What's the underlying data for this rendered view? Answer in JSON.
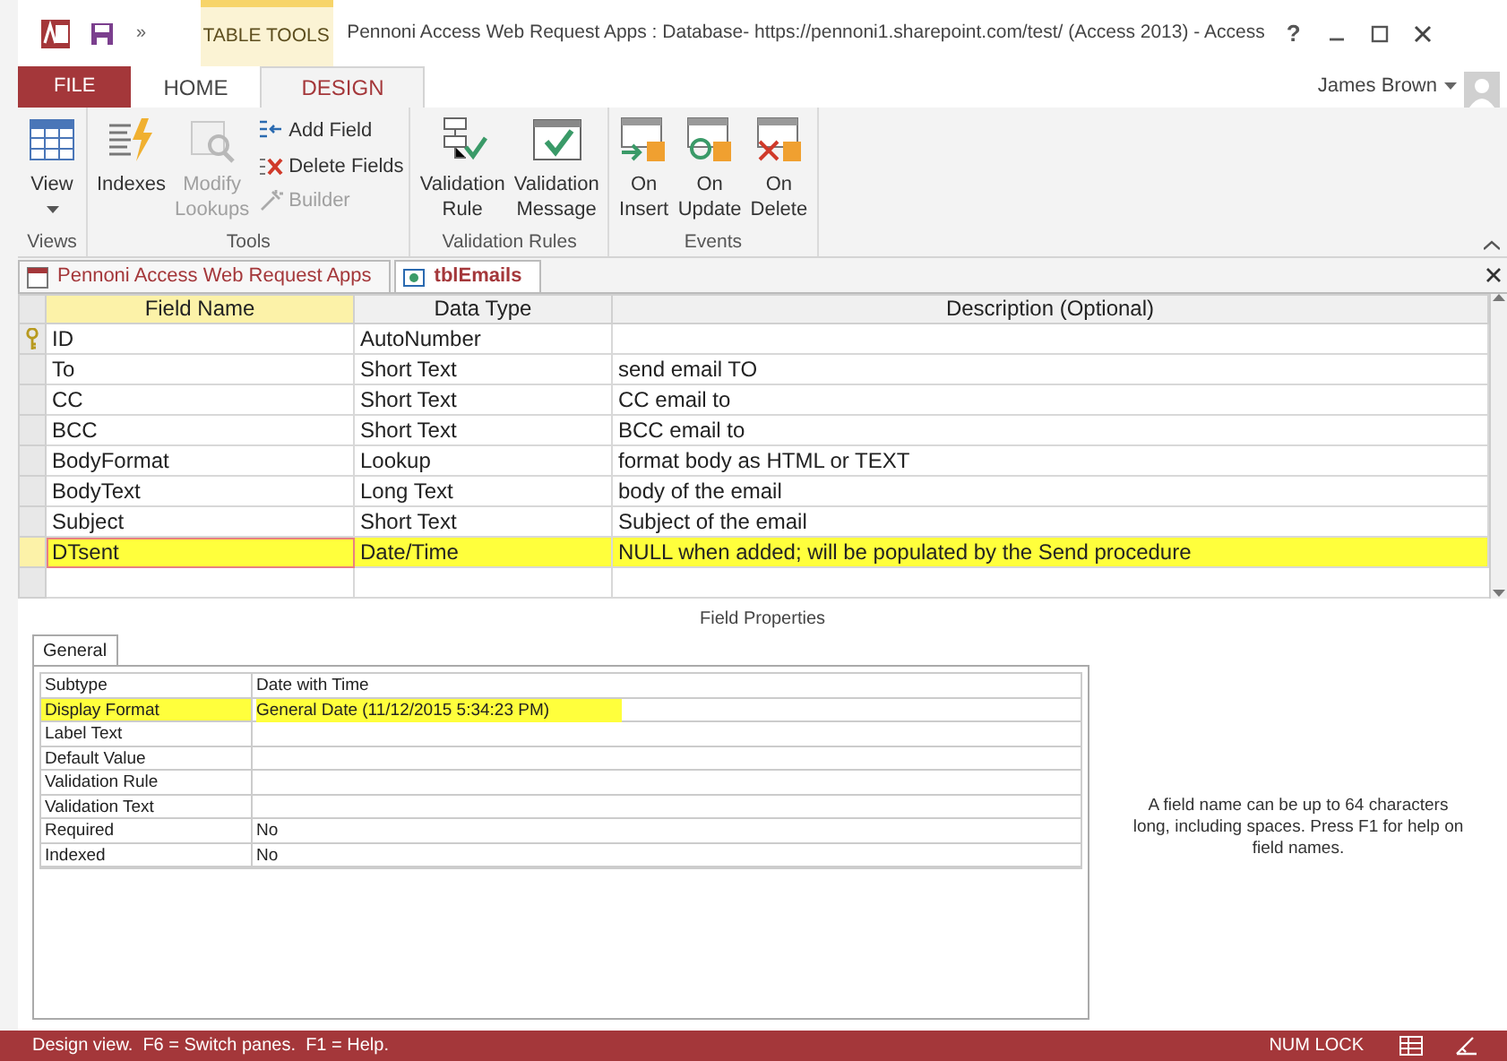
{
  "title_bar": {
    "customize": "»",
    "context_label": "TABLE TOOLS",
    "title": "Pennoni Access Web Request Apps : Database- https://pennoni1.sharepoint.com/test/ (Access 2013) - Access",
    "help": "?"
  },
  "ribbon_tabs": [
    {
      "label": "FILE",
      "kind": "file",
      "selected": false
    },
    {
      "label": "HOME",
      "kind": "tab",
      "selected": false
    },
    {
      "label": "DESIGN",
      "kind": "tab",
      "selected": true
    }
  ],
  "user": {
    "name": "James Brown"
  },
  "ribbon_groups": [
    {
      "label": "Views",
      "buttons": [
        {
          "label": "View",
          "kind": "large",
          "disabled": false,
          "dropdown": true
        }
      ]
    },
    {
      "label": "Tools",
      "buttons": [
        {
          "label": "Indexes",
          "kind": "large",
          "disabled": false
        },
        {
          "label": "Modify Lookups",
          "kind": "large",
          "disabled": true
        },
        {
          "kind": "stack",
          "items": [
            {
              "label": "Add Field",
              "disabled": false
            },
            {
              "label": "Delete Fields",
              "disabled": false
            },
            {
              "label": "Builder",
              "disabled": true
            }
          ]
        }
      ]
    },
    {
      "label": "Validation Rules",
      "buttons": [
        {
          "label": "Validation Rule",
          "kind": "large",
          "disabled": false
        },
        {
          "label": "Validation Message",
          "kind": "large",
          "disabled": false
        }
      ]
    },
    {
      "label": "Events",
      "buttons": [
        {
          "label": "On Insert",
          "kind": "large",
          "disabled": false
        },
        {
          "label": "On Update",
          "kind": "large",
          "disabled": false
        },
        {
          "label": "On Delete",
          "kind": "large",
          "disabled": false
        }
      ]
    }
  ],
  "document_tabs": [
    {
      "label": "Pennoni Access Web Request Apps",
      "selected": false
    },
    {
      "label": "tblEmails",
      "selected": true
    }
  ],
  "table": {
    "columns": [
      "Field Name",
      "Data Type",
      "Description (Optional)"
    ],
    "rows": [
      {
        "field": "ID",
        "type": "AutoNumber",
        "description": "",
        "primary_key": true,
        "selected": false,
        "highlighted": false
      },
      {
        "field": "To",
        "type": "Short Text",
        "description": "send email TO",
        "primary_key": false,
        "selected": false,
        "highlighted": false
      },
      {
        "field": "CC",
        "type": "Short Text",
        "description": "CC email to",
        "primary_key": false,
        "selected": false,
        "highlighted": false
      },
      {
        "field": "BCC",
        "type": "Short Text",
        "description": "BCC email to",
        "primary_key": false,
        "selected": false,
        "highlighted": false
      },
      {
        "field": "BodyFormat",
        "type": "Lookup",
        "description": "format body as HTML or TEXT",
        "primary_key": false,
        "selected": false,
        "highlighted": false
      },
      {
        "field": "BodyText",
        "type": "Long Text",
        "description": "body of the email",
        "primary_key": false,
        "selected": false,
        "highlighted": false
      },
      {
        "field": "Subject",
        "type": "Short Text",
        "description": "Subject of the email",
        "primary_key": false,
        "selected": false,
        "highlighted": false
      },
      {
        "field": "DTsent",
        "type": "Date/Time",
        "description": "NULL when added; will be populated by the Send procedure",
        "primary_key": false,
        "selected": true,
        "highlighted": true
      }
    ]
  },
  "field_properties": {
    "title": "Field Properties",
    "tabs": [
      {
        "label": "General",
        "selected": true
      }
    ],
    "rows": [
      {
        "name": "Subtype",
        "value": "Date with Time",
        "highlighted": false
      },
      {
        "name": "Display Format",
        "value": "General Date (11/12/2015 5:34:23 PM)",
        "highlighted": true
      },
      {
        "name": "Label Text",
        "value": "",
        "highlighted": false
      },
      {
        "name": "Default Value",
        "value": "",
        "highlighted": false
      },
      {
        "name": "Validation Rule",
        "value": "",
        "highlighted": false
      },
      {
        "name": "Validation Text",
        "value": "",
        "highlighted": false
      },
      {
        "name": "Required",
        "value": "No",
        "highlighted": false
      },
      {
        "name": "Indexed",
        "value": "No",
        "highlighted": false
      }
    ],
    "help": "A field name can be up to 64 characters long, including spaces. Press F1 for help on field names."
  },
  "status_bar": {
    "text": "Design view.  F6 = Switch panes.  F1 = Help.",
    "num_lock": "NUM LOCK"
  }
}
